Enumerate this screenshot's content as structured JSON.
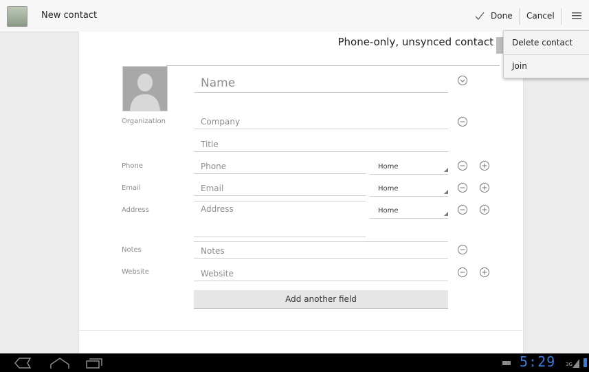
{
  "action_bar": {
    "title": "New contact",
    "done_label": "Done",
    "cancel_label": "Cancel"
  },
  "overflow_menu": {
    "items": [
      {
        "label": "Delete contact"
      },
      {
        "label": "Join"
      }
    ]
  },
  "account": {
    "title": "Phone-only, unsynced contact"
  },
  "form": {
    "name_placeholder": "Name",
    "organization_label": "Organization",
    "company_placeholder": "Company",
    "title_placeholder": "Title",
    "phone_label": "Phone",
    "phone_placeholder": "Phone",
    "phone_type": "Home",
    "email_label": "Email",
    "email_placeholder": "Email",
    "email_type": "Home",
    "address_label": "Address",
    "address_placeholder": "Address",
    "address_type": "Home",
    "notes_label": "Notes",
    "notes_placeholder": "Notes",
    "website_label": "Website",
    "website_placeholder": "Website",
    "add_field_label": "Add another field"
  },
  "status_bar": {
    "time": "5:29",
    "network": "3G"
  },
  "colors": {
    "accent_blue": "#3a7bd5",
    "nav_background": "#000000"
  }
}
